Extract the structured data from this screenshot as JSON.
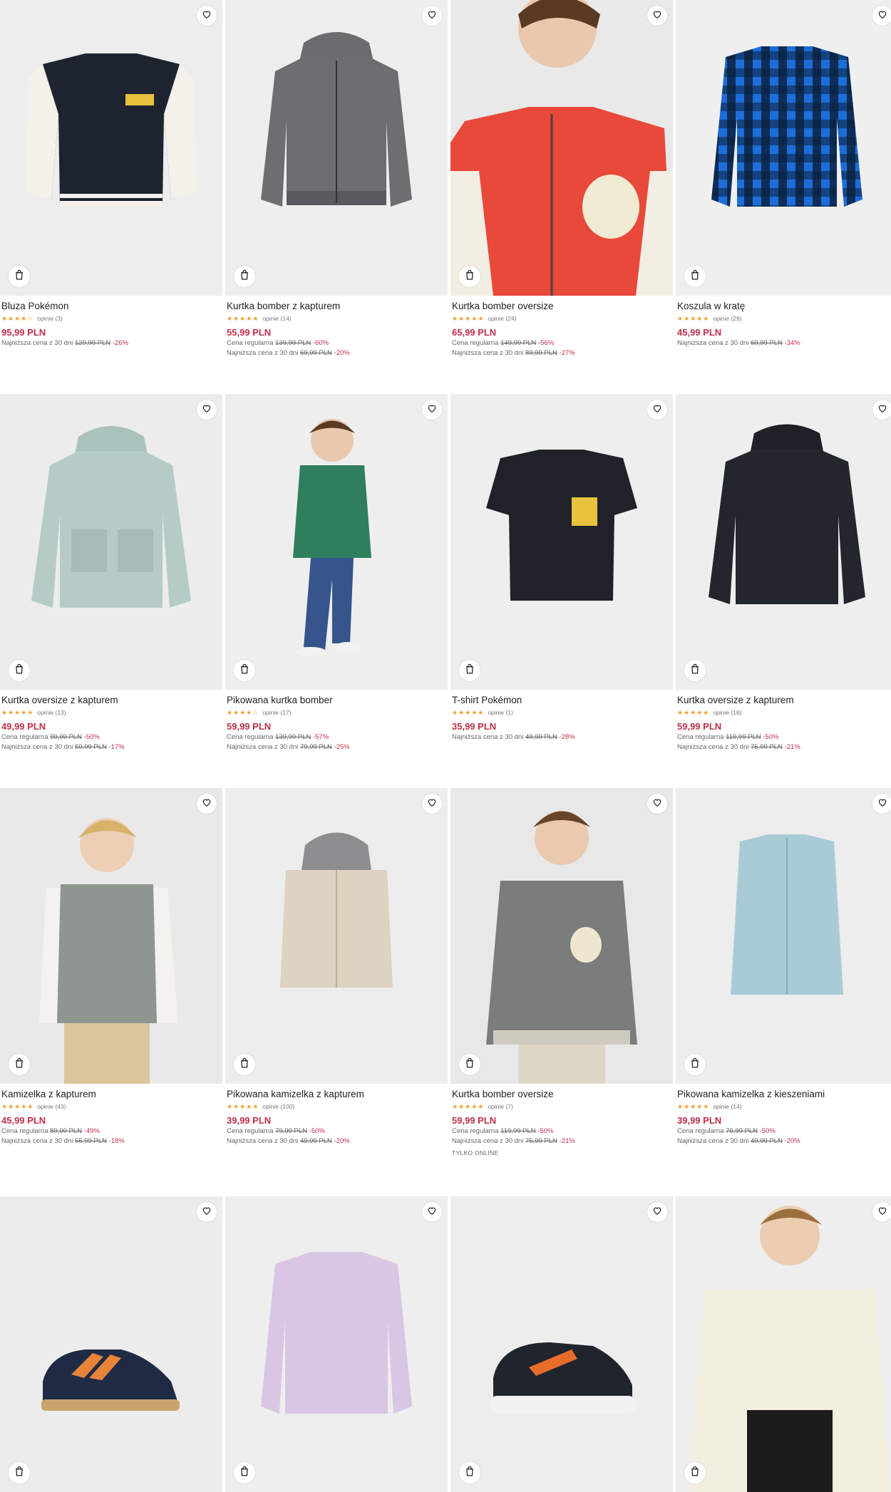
{
  "icons": {
    "favorite": "heart-icon",
    "add_to_cart": "bag-icon"
  },
  "colors": {
    "price": "#c0304a",
    "stars": "#f0a030",
    "image_bg": "#ececec"
  },
  "products": [
    {
      "name": "Bluza Pokémon",
      "stars": "★★★★☆",
      "reviews": "opinie (3)",
      "price": "95,99 PLN",
      "line1": {
        "prefix": "Najniższa cena z 30 dni",
        "old": "129,99 PLN",
        "disc": "-26%"
      },
      "line2": null,
      "tag": null
    },
    {
      "name": "Kurtka bomber z kapturem",
      "stars": "★★★★★",
      "reviews": "opinie (14)",
      "price": "55,99 PLN",
      "line1": {
        "prefix": "Cena regularna",
        "old": "139,99 PLN",
        "disc": "-60%"
      },
      "line2": {
        "prefix": "Najniższa cena z 30 dni",
        "old": "69,99 PLN",
        "disc": "-20%"
      },
      "tag": null
    },
    {
      "name": "Kurtka bomber oversize",
      "stars": "★★★★★",
      "reviews": "opinie (24)",
      "price": "65,99 PLN",
      "line1": {
        "prefix": "Cena regularna",
        "old": "149,99 PLN",
        "disc": "-56%"
      },
      "line2": {
        "prefix": "Najniższa cena z 30 dni",
        "old": "89,99 PLN",
        "disc": "-27%"
      },
      "tag": null
    },
    {
      "name": "Koszula w kratę",
      "stars": "★★★★★",
      "reviews": "opinie (29)",
      "price": "45,99 PLN",
      "line1": {
        "prefix": "Najniższa cena z 30 dni",
        "old": "69,99 PLN",
        "disc": "-34%"
      },
      "line2": null,
      "tag": null
    },
    {
      "name": "Kurtka oversize z kapturem",
      "stars": "★★★★★",
      "reviews": "opinie (13)",
      "price": "49,99 PLN",
      "line1": {
        "prefix": "Cena regularna",
        "old": "99,99 PLN",
        "disc": "-50%"
      },
      "line2": {
        "prefix": "Najniższa cena z 30 dni",
        "old": "59,99 PLN",
        "disc": "-17%"
      },
      "tag": null
    },
    {
      "name": "Pikowana kurtka bomber",
      "stars": "★★★★☆",
      "reviews": "opinie (17)",
      "price": "59,99 PLN",
      "line1": {
        "prefix": "Cena regularna",
        "old": "139,99 PLN",
        "disc": "-57%"
      },
      "line2": {
        "prefix": "Najniższa cena z 30 dni",
        "old": "79,99 PLN",
        "disc": "-25%"
      },
      "tag": null
    },
    {
      "name": "T-shirt Pokémon",
      "stars": "★★★★★",
      "reviews": "opinie (1)",
      "price": "35,99 PLN",
      "line1": {
        "prefix": "Najniższa cena z 30 dni",
        "old": "49,99 PLN",
        "disc": "-28%"
      },
      "line2": null,
      "tag": null
    },
    {
      "name": "Kurtka oversize z kapturem",
      "stars": "★★★★★",
      "reviews": "opinie (16)",
      "price": "59,99 PLN",
      "line1": {
        "prefix": "Cena regularna",
        "old": "119,99 PLN",
        "disc": "-50%"
      },
      "line2": {
        "prefix": "Najniższa cena z 30 dni",
        "old": "75,99 PLN",
        "disc": "-21%"
      },
      "tag": null
    },
    {
      "name": "Kamizelka z kapturem",
      "stars": "★★★★★",
      "reviews": "opinie (43)",
      "price": "45,99 PLN",
      "line1": {
        "prefix": "Cena regularna",
        "old": "89,99 PLN",
        "disc": "-49%"
      },
      "line2": {
        "prefix": "Najniższa cena z 30 dni",
        "old": "55,99 PLN",
        "disc": "-18%"
      },
      "tag": null
    },
    {
      "name": "Pikowana kamizelka z kapturem",
      "stars": "★★★★★",
      "reviews": "opinie (100)",
      "price": "39,99 PLN",
      "line1": {
        "prefix": "Cena regularna",
        "old": "79,99 PLN",
        "disc": "-50%"
      },
      "line2": {
        "prefix": "Najniższa cena z 30 dni",
        "old": "49,99 PLN",
        "disc": "-20%"
      },
      "tag": null
    },
    {
      "name": "Kurtka bomber oversize",
      "stars": "★★★★★",
      "reviews": "opinie (7)",
      "price": "59,99 PLN",
      "line1": {
        "prefix": "Cena regularna",
        "old": "119,99 PLN",
        "disc": "-50%"
      },
      "line2": {
        "prefix": "Najniższa cena z 30 dni",
        "old": "75,99 PLN",
        "disc": "-21%"
      },
      "tag": "TYLKO ONLINE"
    },
    {
      "name": "Pikowana kamizelka z kieszeniami",
      "stars": "★★★★★",
      "reviews": "opinie (14)",
      "price": "39,99 PLN",
      "line1": {
        "prefix": "Cena regularna",
        "old": "79,99 PLN",
        "disc": "-50%"
      },
      "line2": {
        "prefix": "Najniższa cena z 30 dni",
        "old": "49,99 PLN",
        "disc": "-20%"
      },
      "tag": null
    },
    {
      "name": "",
      "stars": "",
      "reviews": "",
      "price": "",
      "line1": null,
      "line2": null,
      "tag": null
    },
    {
      "name": "",
      "stars": "",
      "reviews": "",
      "price": "",
      "line1": null,
      "line2": null,
      "tag": null
    },
    {
      "name": "",
      "stars": "",
      "reviews": "",
      "price": "",
      "line1": null,
      "line2": null,
      "tag": null
    },
    {
      "name": "",
      "stars": "",
      "reviews": "",
      "price": "",
      "line1": null,
      "line2": null,
      "tag": null
    }
  ]
}
